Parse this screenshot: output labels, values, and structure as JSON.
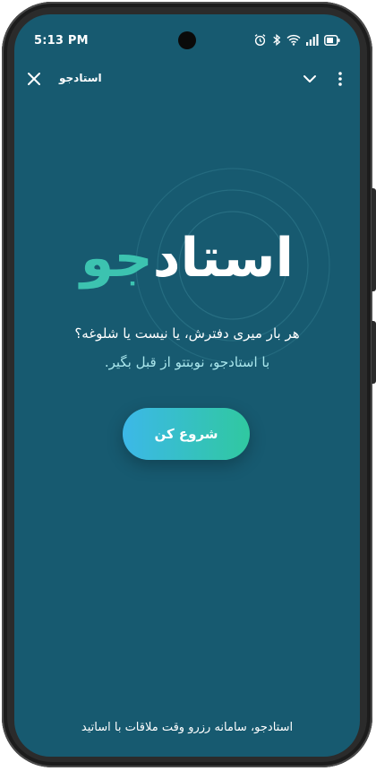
{
  "status_bar": {
    "time": "5:13 PM",
    "icons": [
      "alarm-icon",
      "bluetooth-icon",
      "wifi-icon",
      "signal-icon",
      "battery-icon"
    ]
  },
  "top_bar": {
    "title": "استادجو",
    "close_icon": "close-icon",
    "chevron_icon": "chevron-down-icon",
    "more_icon": "more-vertical-icon"
  },
  "hero": {
    "logo_part1": "استاد",
    "logo_part2": "جو",
    "tagline_line1": "هر بار میری دفترش، یا نیست یا شلوغه؟",
    "tagline_line2": "با استادجو، نوبتتو از قبل بگیر."
  },
  "cta": {
    "label": "شروع کن"
  },
  "footer": {
    "text": "استادجو، سامانه رزرو وقت ملاقات با اساتید"
  },
  "colors": {
    "background": "#175a70",
    "accent": "#3cc3b0",
    "button_start": "#3cb8e8",
    "button_end": "#30c8a0"
  }
}
